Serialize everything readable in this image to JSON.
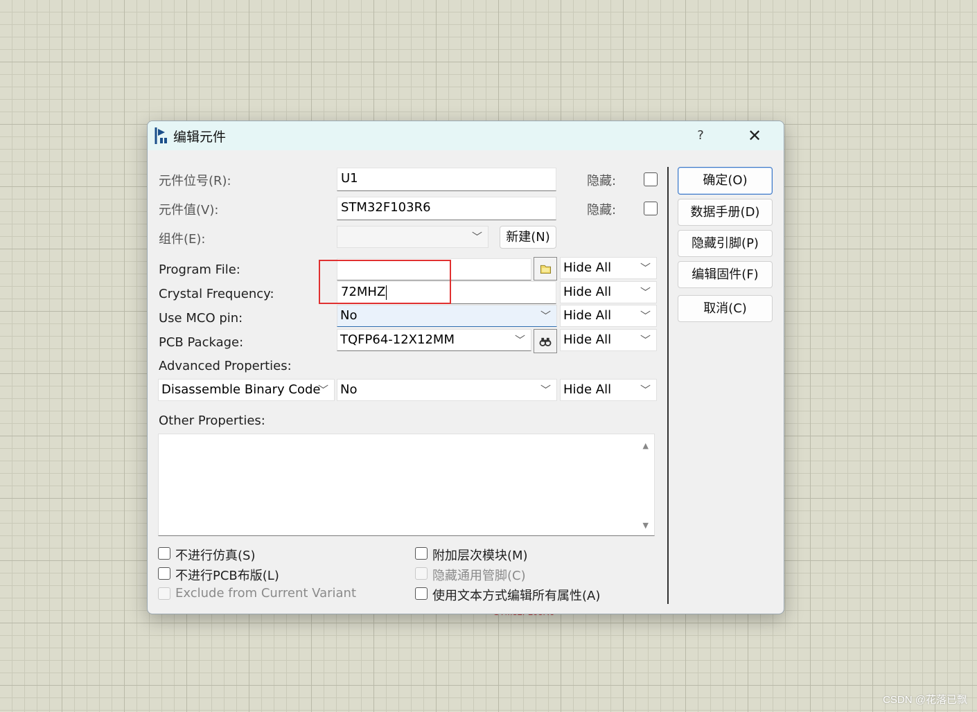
{
  "background_label": "STM32F103R6",
  "watermark": "CSDN @花落已飘",
  "dialog": {
    "title": "编辑元件",
    "help_label": "?",
    "close_label": "✕",
    "part_reference": {
      "label": "元件位号(R):",
      "value": "U1",
      "hidden_label": "隐藏:",
      "hidden": false
    },
    "part_value": {
      "label": "元件值(V):",
      "value": "STM32F103R6",
      "hidden_label": "隐藏:",
      "hidden": false
    },
    "element": {
      "label": "组件(E):",
      "value": "",
      "new_button": "新建(N)"
    },
    "properties": [
      {
        "label": "Program File:",
        "value": "",
        "visibility": "Hide All"
      },
      {
        "label": "Crystal Frequency:",
        "value": "72MHZ",
        "visibility": "Hide All"
      },
      {
        "label": "Use MCO pin:",
        "value": "No",
        "visibility": "Hide All"
      },
      {
        "label": "PCB Package:",
        "value": "TQFP64-12X12MM",
        "visibility": "Hide All"
      }
    ],
    "advanced": {
      "label": "Advanced Properties:",
      "property": "Disassemble Binary Code",
      "value": "No",
      "visibility": "Hide All"
    },
    "other": {
      "label": "Other Properties:",
      "value": ""
    },
    "options": [
      {
        "label": "不进行仿真(S)",
        "checked": false,
        "disabled": false
      },
      {
        "label": "不进行PCB布版(L)",
        "checked": false,
        "disabled": false
      },
      {
        "label": "Exclude from Current Variant",
        "checked": false,
        "disabled": true
      },
      {
        "label": "附加层次模块(M)",
        "checked": false,
        "disabled": false
      },
      {
        "label": "隐藏通用管脚(C)",
        "checked": false,
        "disabled": true
      },
      {
        "label": "使用文本方式编辑所有属性(A)",
        "checked": false,
        "disabled": false
      }
    ],
    "buttons": {
      "ok": "确定(O)",
      "datasheet": "数据手册(D)",
      "hidden_pins": "隐藏引脚(P)",
      "edit_firmware": "编辑固件(F)",
      "cancel": "取消(C)"
    },
    "colors": {
      "title_bar": "#e6f6f6",
      "highlight_box": "#e03030",
      "canvas_grid": "#dcdccc"
    }
  }
}
